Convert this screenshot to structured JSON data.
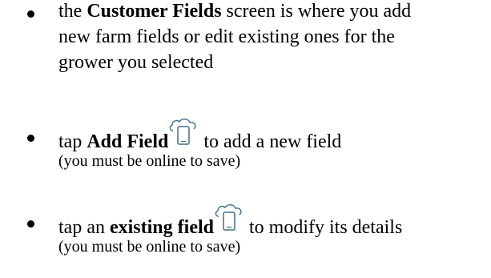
{
  "bullets": [
    {
      "lines": [
        {
          "pre": "the ",
          "bold": "Customer Fields",
          "post": " screen is where you add"
        },
        {
          "text": "new farm fields or edit existing ones for the"
        },
        {
          "text": "grower you selected"
        }
      ]
    },
    {
      "pre": "tap ",
      "bold": "Add Field",
      "icon": "cloud-device-icon",
      "post": " to add a new field",
      "note": "(you must be online to save)"
    },
    {
      "pre": "tap an ",
      "bold": "existing field",
      "icon": "cloud-device-icon",
      "post": " to modify its details",
      "note": "(you must be online to save)"
    }
  ]
}
